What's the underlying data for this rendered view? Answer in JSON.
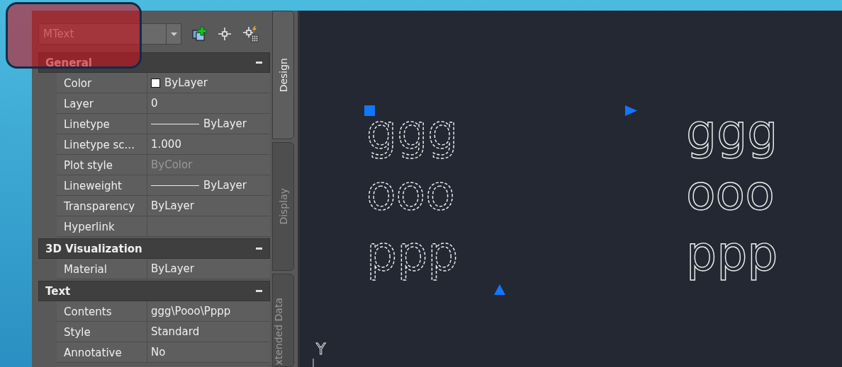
{
  "object_type": {
    "value": "MText"
  },
  "sections": [
    {
      "title": "General",
      "expanded": true,
      "rows": [
        {
          "label": "Color",
          "value": "ByLayer",
          "kind": "swatch",
          "disabled": false
        },
        {
          "label": "Layer",
          "value": "0",
          "kind": "text",
          "disabled": false
        },
        {
          "label": "Linetype",
          "value": "ByLayer",
          "kind": "line",
          "disabled": false
        },
        {
          "label": "Linetype sc...",
          "value": "1.000",
          "kind": "text",
          "disabled": false
        },
        {
          "label": "Plot style",
          "value": "ByColor",
          "kind": "text",
          "disabled": true
        },
        {
          "label": "Lineweight",
          "value": "ByLayer",
          "kind": "line",
          "disabled": false
        },
        {
          "label": "Transparency",
          "value": "ByLayer",
          "kind": "text",
          "disabled": false
        },
        {
          "label": "Hyperlink",
          "value": "",
          "kind": "text",
          "disabled": false
        }
      ]
    },
    {
      "title": "3D Visualization",
      "expanded": true,
      "rows": [
        {
          "label": "Material",
          "value": "ByLayer",
          "kind": "text",
          "disabled": false
        }
      ]
    },
    {
      "title": "Text",
      "expanded": true,
      "rows": [
        {
          "label": "Contents",
          "value": "ggg\\Pooo\\Pppp",
          "kind": "text",
          "disabled": false
        },
        {
          "label": "Style",
          "value": "Standard",
          "kind": "text",
          "disabled": false
        },
        {
          "label": "Annotative",
          "value": "No",
          "kind": "text",
          "disabled": false
        }
      ]
    }
  ],
  "tabs": [
    {
      "label": "Design",
      "selected": true
    },
    {
      "label": "Display",
      "selected": false
    },
    {
      "label": "xtended Data",
      "selected": false
    }
  ],
  "drawing": {
    "objects": [
      {
        "lines": [
          "ggg",
          "ooo",
          "ppp"
        ],
        "selected": true
      },
      {
        "lines": [
          "ggg",
          "ooo",
          "ppp"
        ],
        "selected": false
      }
    ],
    "ucs_label": "Y"
  }
}
